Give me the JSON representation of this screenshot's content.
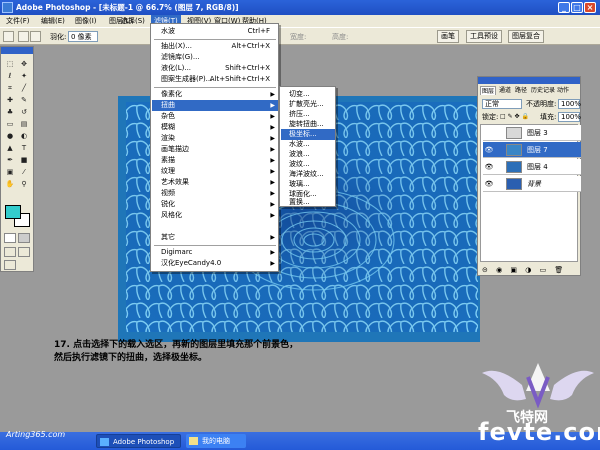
{
  "window": {
    "title": "Adobe Photoshop - [未标题-1 @ 66.7% (图层 7, RGB/8)]",
    "controls": [
      "_",
      "□",
      "×"
    ]
  },
  "menubar": {
    "items": [
      "文件(F)",
      "编辑(E)",
      "图像(I)",
      "图层(L)",
      "选择(S)",
      "滤镜(T)",
      "视图(V)",
      "窗口(W)",
      "帮助(H)"
    ],
    "active": "滤镜(T)"
  },
  "options_bar": {
    "feather_label": "羽化:",
    "feather_value": "0 像素",
    "width_label": "宽度:",
    "height_label": "高度:",
    "well_items": [
      "画笔",
      "工具预设",
      "图层复合"
    ]
  },
  "filter_menu": {
    "items": [
      {
        "label": "水波",
        "shortcut": "Ctrl+F",
        "arrow": false,
        "selected": false,
        "group": 0
      },
      {
        "label": "抽出(X)...",
        "shortcut": "Alt+Ctrl+X",
        "arrow": false,
        "selected": false,
        "group": 1
      },
      {
        "label": "滤镜库(G)...",
        "shortcut": "",
        "arrow": false,
        "selected": false,
        "group": 1
      },
      {
        "label": "液化(L)...",
        "shortcut": "Shift+Ctrl+X",
        "arrow": false,
        "selected": false,
        "group": 1
      },
      {
        "label": "图案生成器(P)...",
        "shortcut": "Alt+Shift+Ctrl+X",
        "arrow": false,
        "selected": false,
        "group": 1
      },
      {
        "label": "像素化",
        "shortcut": "",
        "arrow": true,
        "selected": false,
        "group": 2
      },
      {
        "label": "扭曲",
        "shortcut": "",
        "arrow": true,
        "selected": true,
        "group": 2
      },
      {
        "label": "杂色",
        "shortcut": "",
        "arrow": true,
        "selected": false,
        "group": 2
      },
      {
        "label": "模糊",
        "shortcut": "",
        "arrow": true,
        "selected": false,
        "group": 2
      },
      {
        "label": "渲染",
        "shortcut": "",
        "arrow": true,
        "selected": false,
        "group": 2
      },
      {
        "label": "画笔描边",
        "shortcut": "",
        "arrow": true,
        "selected": false,
        "group": 2
      },
      {
        "label": "素描",
        "shortcut": "",
        "arrow": true,
        "selected": false,
        "group": 2
      },
      {
        "label": "纹理",
        "shortcut": "",
        "arrow": true,
        "selected": false,
        "group": 2
      },
      {
        "label": "艺术效果",
        "shortcut": "",
        "arrow": true,
        "selected": false,
        "group": 2
      },
      {
        "label": "视频",
        "shortcut": "",
        "arrow": true,
        "selected": false,
        "group": 2
      },
      {
        "label": "锐化",
        "shortcut": "",
        "arrow": true,
        "selected": false,
        "group": 2
      },
      {
        "label": "风格化",
        "shortcut": "",
        "arrow": true,
        "selected": false,
        "group": 2
      },
      {
        "label": "其它",
        "shortcut": "",
        "arrow": true,
        "selected": false,
        "group": 2
      },
      {
        "label": "Digimarc",
        "shortcut": "",
        "arrow": true,
        "selected": false,
        "group": 3
      },
      {
        "label": "汉化EyeCandy4.0",
        "shortcut": "",
        "arrow": true,
        "selected": false,
        "group": 3
      }
    ]
  },
  "distort_submenu": {
    "items": [
      "切变...",
      "扩散亮光...",
      "挤压...",
      "旋转扭曲...",
      "极坐标...",
      "水波...",
      "波浪...",
      "波纹...",
      "海洋波纹...",
      "玻璃...",
      "球面化...",
      "置换..."
    ],
    "selected": "极坐标..."
  },
  "layers_panel": {
    "tabs": [
      "图层",
      "通道",
      "路径",
      "历史记录",
      "动作"
    ],
    "active_tab": "图层",
    "blend_mode": "正常",
    "opacity_label": "不透明度:",
    "opacity_value": "100%",
    "lock_label": "锁定:",
    "fill_label": "填充:",
    "fill_value": "100%",
    "layers": [
      {
        "name": "图层 3",
        "visible": false,
        "selected": false,
        "thumb": "#d8d8d8"
      },
      {
        "name": "图层 7",
        "visible": true,
        "selected": true,
        "thumb": "#3a86c6"
      },
      {
        "name": "图层 4",
        "visible": true,
        "selected": false,
        "thumb": "#2c6fb8"
      },
      {
        "name": "背景",
        "visible": true,
        "selected": false,
        "thumb": "#2b5fb0"
      }
    ]
  },
  "caption": {
    "line1": "17. 点击选择下的载入选区，再新的图层里填充那个前景色，",
    "line2": "然后执行滤镜下的扭曲，选择极坐标。"
  },
  "taskbar": {
    "items": [
      "Adobe Photoshop",
      "我的电脑"
    ]
  },
  "watermarks": {
    "site": "Arting365.com",
    "logo_text": "飞特网",
    "logo_domain": "fevte.com"
  },
  "colors": {
    "foreground": "#33cccc",
    "background": "#ffffff",
    "accent": "#316ac5"
  }
}
